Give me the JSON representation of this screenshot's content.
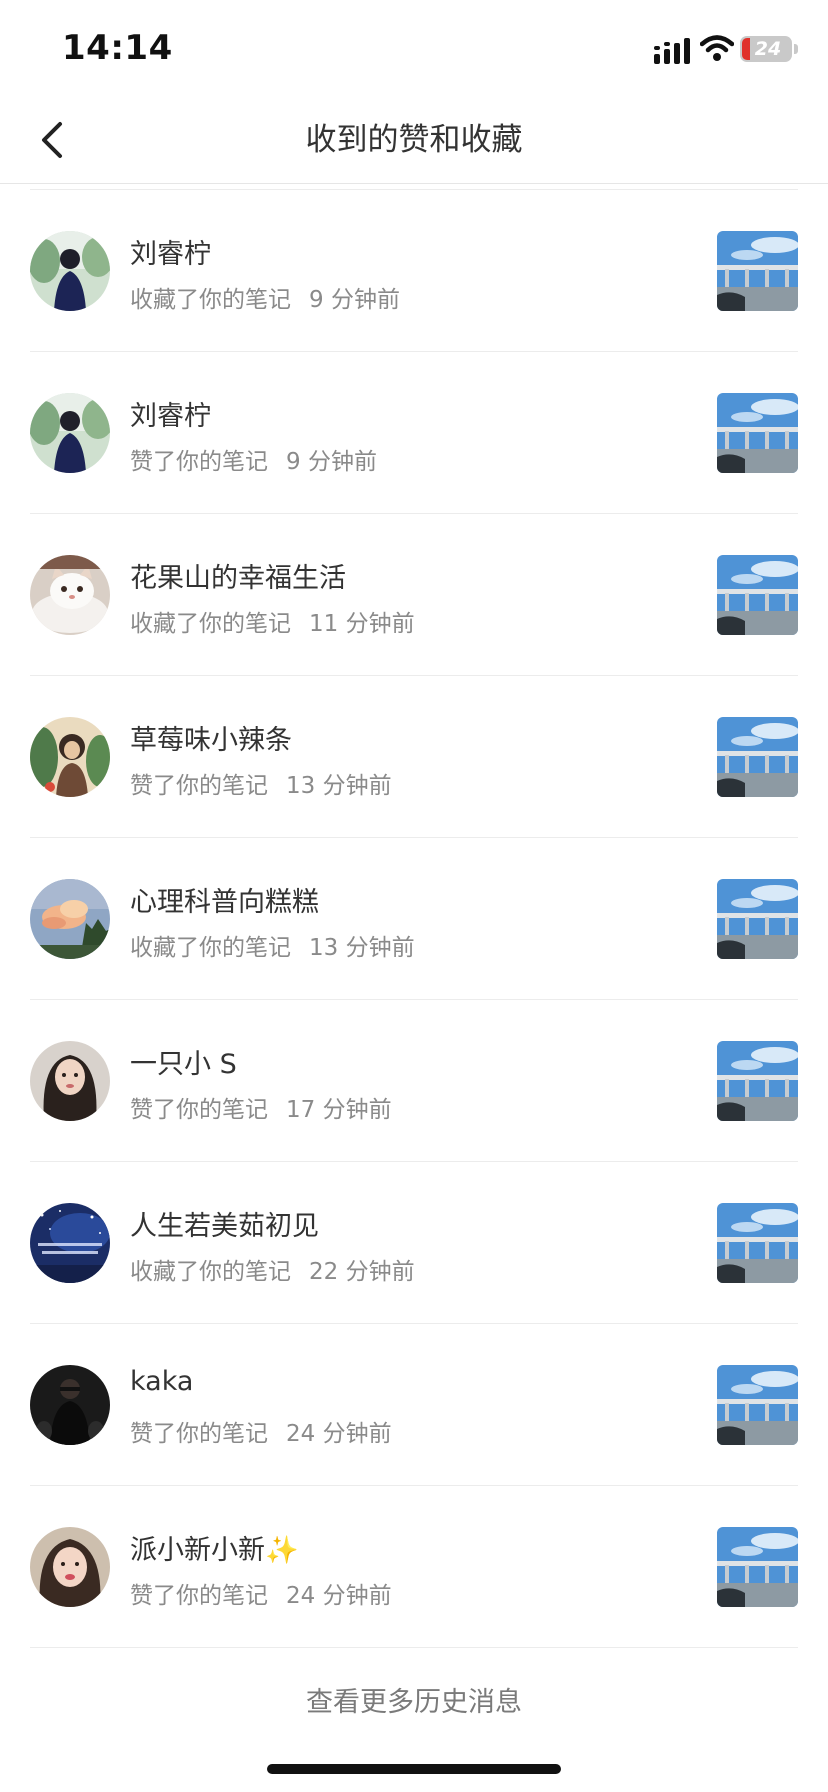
{
  "status_bar": {
    "time": "14:14",
    "battery": "24"
  },
  "nav": {
    "title": "收到的赞和收藏"
  },
  "notifications": [
    {
      "name": "刘睿柠",
      "action": "收藏了你的笔记",
      "time": "9 分钟前",
      "avatar": "avatar-girl-green"
    },
    {
      "name": "刘睿柠",
      "action": "赞了你的笔记",
      "time": "9 分钟前",
      "avatar": "avatar-girl-green"
    },
    {
      "name": "花果山的幸福生活",
      "action": "收藏了你的笔记",
      "time": "11 分钟前",
      "avatar": "avatar-cat"
    },
    {
      "name": "草莓味小辣条",
      "action": "赞了你的笔记",
      "time": "13 分钟前",
      "avatar": "avatar-illustration"
    },
    {
      "name": "心理科普向糕糕",
      "action": "收藏了你的笔记",
      "time": "13 分钟前",
      "avatar": "avatar-sunset-cloud"
    },
    {
      "name": "一只小 S",
      "action": "赞了你的笔记",
      "time": "17 分钟前",
      "avatar": "avatar-girl-portrait"
    },
    {
      "name": "人生若美茹初见",
      "action": "收藏了你的笔记",
      "time": "22 分钟前",
      "avatar": "avatar-starry-night"
    },
    {
      "name": "kaka",
      "action": "赞了你的笔记",
      "time": "24 分钟前",
      "avatar": "avatar-dark-figure"
    },
    {
      "name": "派小新小新✨",
      "action": "赞了你的笔记",
      "time": "24 分钟前",
      "avatar": "avatar-girl-selfie"
    }
  ],
  "note_thumbnail": "bridge-sky-photo",
  "footer": {
    "more_label": "查看更多历史消息"
  },
  "colors": {
    "name": "#333333",
    "meta": "#8a8a8a",
    "divider": "#ececec",
    "sky": "#4f93d6"
  }
}
